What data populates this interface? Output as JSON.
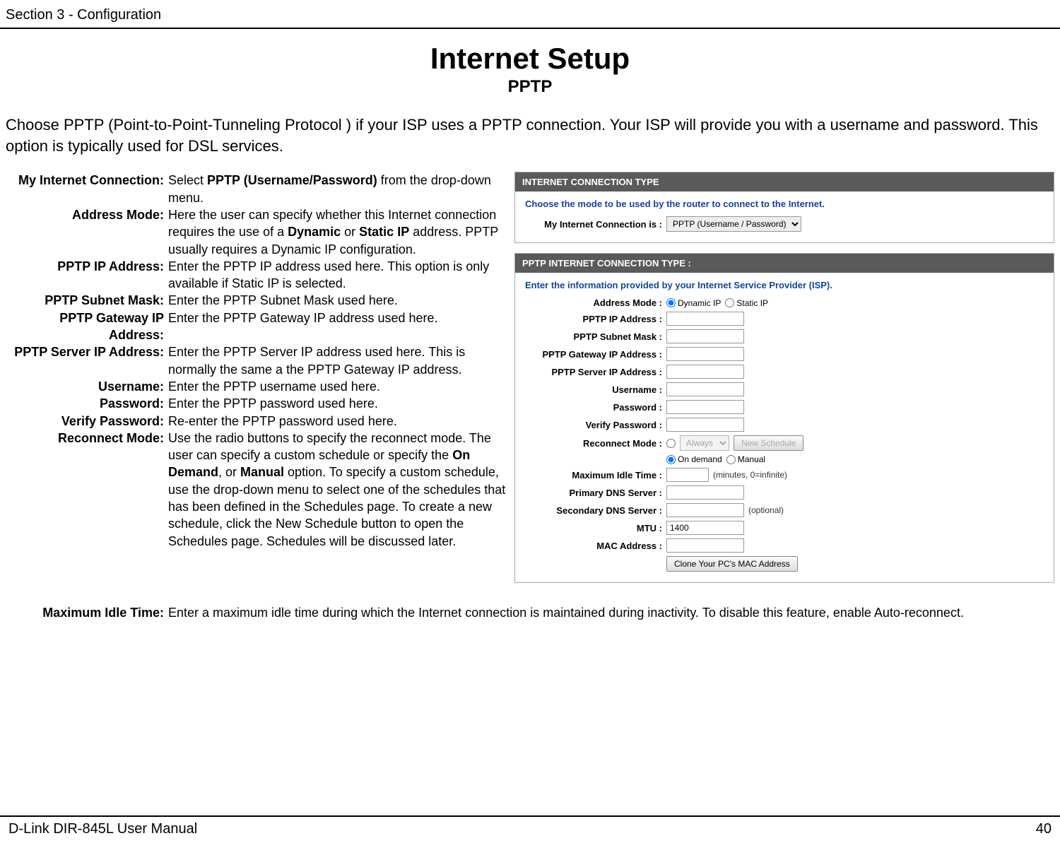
{
  "header": {
    "section": "Section 3 - Configuration"
  },
  "title": {
    "main": "Internet Setup",
    "sub": "PPTP"
  },
  "intro": "Choose PPTP (Point-to-Point-Tunneling Protocol ) if your ISP uses a PPTP connection. Your ISP will provide you with a username and password. This option is typically used for DSL services.",
  "defs": {
    "my_internet_connection": {
      "label": "My Internet Connection:",
      "pre": "Select ",
      "bold": "PPTP (Username/Password)",
      "post": " from the drop-down menu."
    },
    "address_mode": {
      "label": "Address Mode:",
      "pre": "Here the user can specify whether this Internet connection requires the use of a ",
      "b1": "Dynamic",
      "mid": " or ",
      "b2": "Static IP",
      "post": " address. PPTP usually requires a Dynamic IP configuration."
    },
    "pptp_ip": {
      "label": "PPTP IP Address:",
      "text": "Enter the PPTP IP address used here. This option is only available if Static IP is selected."
    },
    "pptp_subnet": {
      "label": "PPTP Subnet Mask:",
      "text": "Enter the PPTP Subnet Mask used here."
    },
    "pptp_gateway": {
      "label": "PPTP Gateway IP Address:",
      "text": "Enter the PPTP Gateway IP address used here."
    },
    "pptp_server": {
      "label": "PPTP Server IP Address:",
      "text": "Enter the PPTP Server IP address used here. This is normally the same a the PPTP Gateway IP address."
    },
    "username": {
      "label": "Username:",
      "text": "Enter the PPTP username used here."
    },
    "password": {
      "label": "Password:",
      "text": "Enter the PPTP password used here."
    },
    "verify_password": {
      "label": "Verify Password:",
      "text": "Re-enter the PPTP password used here."
    },
    "reconnect_mode": {
      "label": "Reconnect Mode:",
      "pre": "Use the radio buttons to specify the reconnect mode. The user can specify a custom schedule or specify the ",
      "b1": "On Demand",
      "mid": ", or ",
      "b2": "Manual",
      "post": " option. To specify a custom schedule, use the drop-down menu to select one of the schedules that has been defined in the Schedules page. To create a new schedule, click the New Schedule button to open the Schedules page. Schedules will be discussed later."
    },
    "max_idle": {
      "label": "Maximum Idle Time:",
      "text": "Enter a maximum idle time during which the Internet connection is maintained during inactivity. To disable this feature, enable Auto-reconnect."
    }
  },
  "panel1": {
    "head": "INTERNET CONNECTION TYPE",
    "desc": "Choose the mode to be used by the router to connect to the Internet.",
    "field_label": "My Internet Connection is  :",
    "select_value": "PPTP (Username / Password)"
  },
  "panel2": {
    "head": "PPTP INTERNET CONNECTION TYPE :",
    "desc": "Enter the information provided by your Internet Service Provider (ISP).",
    "labels": {
      "address_mode": "Address Mode  :",
      "pptp_ip": "PPTP IP Address  :",
      "pptp_subnet": "PPTP Subnet Mask  :",
      "pptp_gateway": "PPTP Gateway IP Address  :",
      "pptp_server": "PPTP Server IP Address  :",
      "username": "Username  :",
      "password": "Password  :",
      "verify_password": "Verify Password  :",
      "reconnect_mode": "Reconnect Mode  :",
      "max_idle": "Maximum Idle Time  :",
      "primary_dns": "Primary DNS Server  :",
      "secondary_dns": "Secondary DNS Server  :",
      "mtu": "MTU  :",
      "mac": "MAC Address  :"
    },
    "radios": {
      "dynamic_ip": "Dynamic IP",
      "static_ip": "Static IP",
      "on_demand": "On demand",
      "manual": "Manual"
    },
    "schedule_select": "Always o",
    "new_schedule_btn": "New Schedule",
    "idle_suffix": "(minutes, 0=infinite)",
    "dns_suffix": "(optional)",
    "mtu_value": "1400",
    "clone_btn": "Clone Your PC's MAC Address"
  },
  "footer": {
    "manual": "D-Link DIR-845L User Manual",
    "page": "40"
  }
}
